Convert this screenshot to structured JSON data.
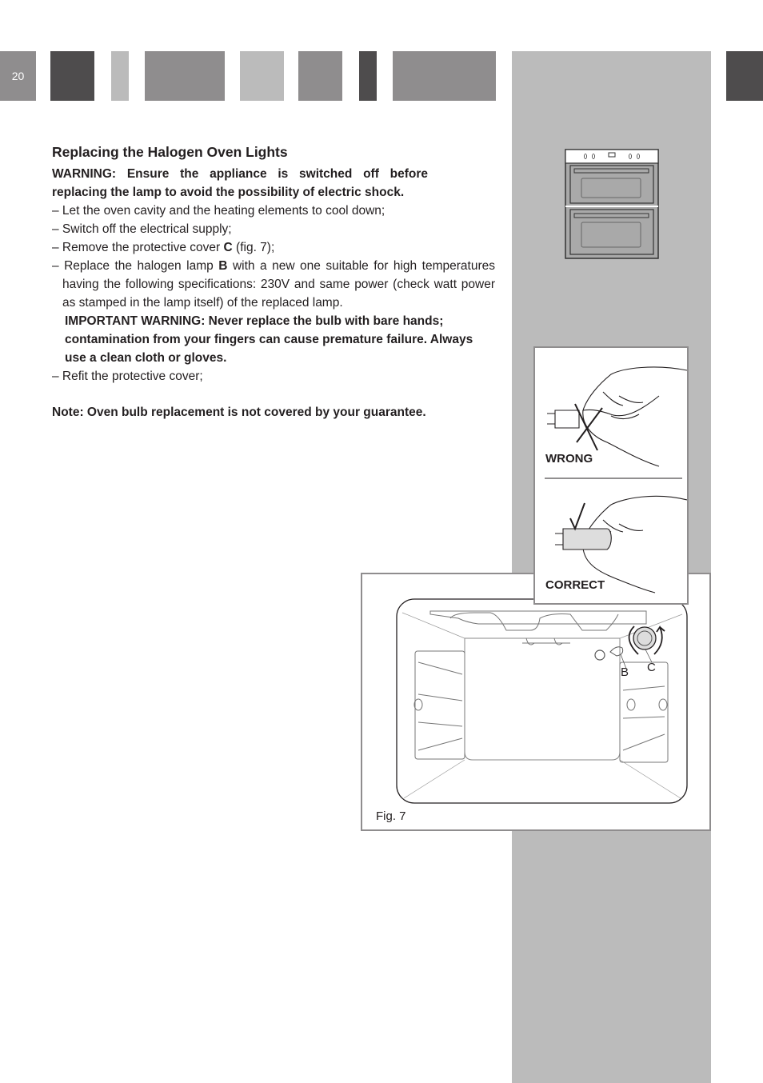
{
  "page": {
    "number": "20"
  },
  "section": {
    "title": "Replacing the Halogen Oven Lights",
    "warning": "WARNING: Ensure the appliance is switched off before replacing the lamp to avoid the possibility of electric shock.",
    "steps": [
      "– Let the oven cavity and the heating elements to cool down;",
      "– Switch off the electrical supply;"
    ],
    "step_remove": {
      "prefix": "– Remove the protective cover ",
      "bold": "C",
      "suffix": " (fig. 7);"
    },
    "step_replace": {
      "prefix": "– Replace the halogen lamp ",
      "bold": "B",
      "suffix": " with a new one suitable for high temperatures having the following specifications: 230V and same power (check watt power as stamped in the lamp itself) of the replaced lamp."
    },
    "important_warning": "IMPORTANT WARNING: Never replace the bulb with bare hands; contamination from your fingers can cause premature failure. Always use a clean cloth or gloves.",
    "step_refit": "– Refit the protective cover;",
    "note": "Note: Oven bulb replacement is not covered by your guarantee."
  },
  "figures": {
    "hands": {
      "wrong_label": "WRONG",
      "correct_label": "CORRECT"
    },
    "fig7": {
      "caption": "Fig. 7",
      "label_b": "B",
      "label_c": "C"
    }
  },
  "colors": {
    "dark": "#4e4c4d",
    "mid": "#8f8d8e",
    "light": "#bbbbbb"
  }
}
